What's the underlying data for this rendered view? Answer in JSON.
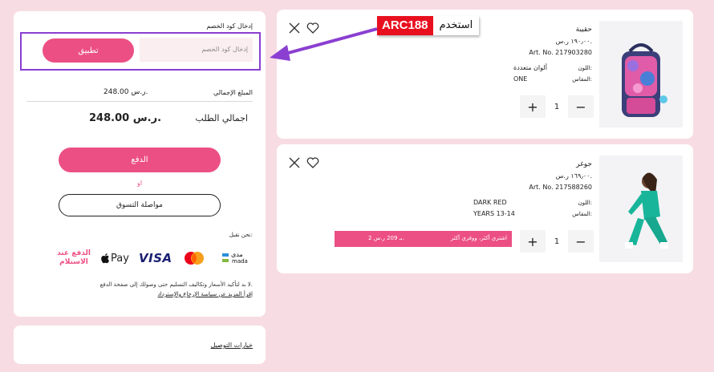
{
  "products": [
    {
      "name": "حقيبة",
      "price": "١٩٠٫٠٠ ر.س.",
      "art_no": "Art. No. 217903280",
      "color_label": "اللون:",
      "color_value": "ألوان متعددة",
      "size_label": "المقاس:",
      "size_value": "ONE",
      "qty": "1"
    },
    {
      "name": "جوغر",
      "price": "١٦٩٫٠٠ ر.س.",
      "art_no": "Art. No. 217588260",
      "color_label": "اللون:",
      "color_value": "DARK RED",
      "size_label": "المقاس:",
      "size_value": "YEARS 13-14",
      "qty": "1",
      "promo_text": "اشتري أكثر، ووفري أكثر",
      "promo_value": "2 بـ 209 ر.س."
    }
  ],
  "annotation": {
    "code": "ARC188",
    "use_label": "استخدم"
  },
  "summary": {
    "coupon_title": "إدخال كود الخصم",
    "coupon_placeholder": "إدخال كود الخصم",
    "apply_label": "تطبيق",
    "subtotal_label": "المبلغ الإجمالي",
    "subtotal_value": "248.00 ر.س.",
    "total_label": "اجمالي الطلب",
    "total_value": "248.00 ر.س.",
    "pay_label": "الدفع",
    "or_label": "او",
    "continue_label": "مواصلة التسوق",
    "accept_label": "نحن نقبل:",
    "cod_label": "الدفع عند الاستلام",
    "applepay_label": "Pay",
    "visa_label": "VISA",
    "mada_top": "مدى",
    "mada_bottom": "mada",
    "note": "لا بد لتأكيد الأسعار وتكاليف التسليم حتى وصولك إلى صفحة الدفع.",
    "policy_link": "إقرأ المزيد عن سياسة الإرجاع والإسترداد"
  },
  "delivery": {
    "options_link": "خيارات التوصيل"
  },
  "colors": {
    "accent": "#ec4f84",
    "arrow": "#8b3fd1",
    "background": "#f7dde3",
    "tag_red": "#e8101f"
  }
}
